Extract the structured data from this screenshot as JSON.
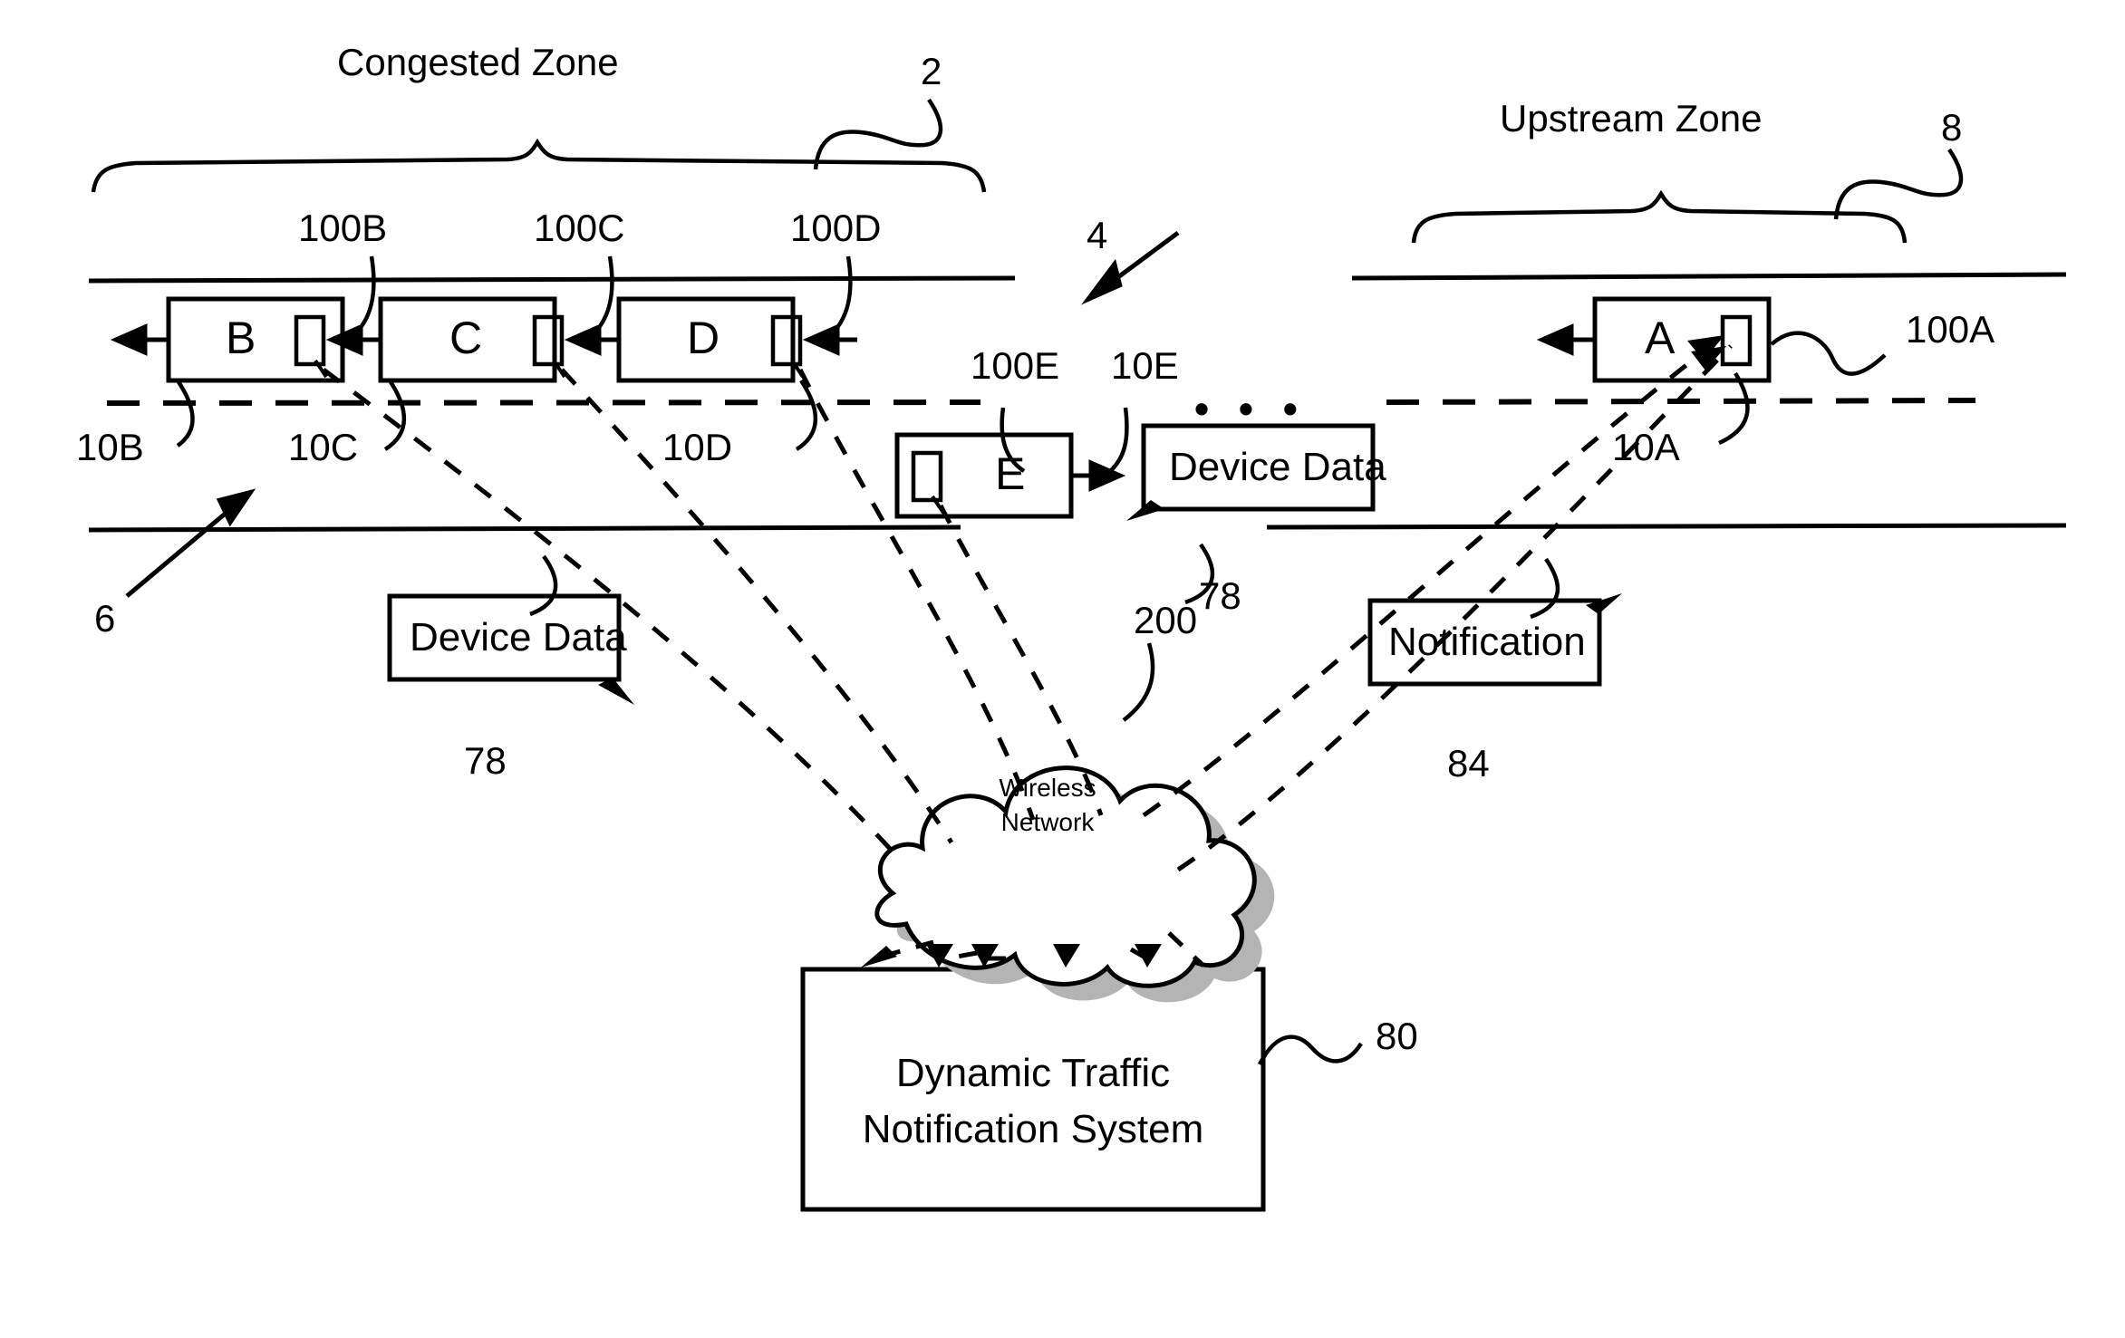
{
  "figure": {
    "zones": [
      {
        "id": "congested",
        "label": "Congested Zone",
        "ref": "2"
      },
      {
        "id": "upstream",
        "label": "Upstream Zone",
        "ref": "8"
      }
    ],
    "road_refs": {
      "lane_divider_ref": "4",
      "roadway_ref": "6"
    },
    "vehicles": [
      {
        "letter": "B",
        "device_ref": "100B",
        "vehicle_ref": "10B"
      },
      {
        "letter": "C",
        "device_ref": "100C",
        "vehicle_ref": "10C"
      },
      {
        "letter": "D",
        "device_ref": "100D",
        "vehicle_ref": "10D"
      },
      {
        "letter": "E",
        "device_ref": "100E",
        "vehicle_ref": "10E"
      },
      {
        "letter": "A",
        "device_ref": "100A",
        "vehicle_ref": "10A"
      }
    ],
    "ellipsis": "• • •",
    "data_boxes": [
      {
        "id": "device-data-left",
        "label": "Device Data",
        "ref": "78"
      },
      {
        "id": "device-data-right",
        "label": "Device Data",
        "ref": "78"
      },
      {
        "id": "notification",
        "label": "Notification",
        "ref": "84"
      }
    ],
    "cloud": {
      "line1": "Wireless",
      "line2": "Network",
      "ref": "200"
    },
    "system": {
      "line1": "Dynamic Traffic",
      "line2": "Notification System",
      "ref": "80"
    },
    "colors": {
      "ink": "#000000",
      "paper": "#ffffff",
      "cloud_shadow": "#b4b4b4"
    }
  }
}
